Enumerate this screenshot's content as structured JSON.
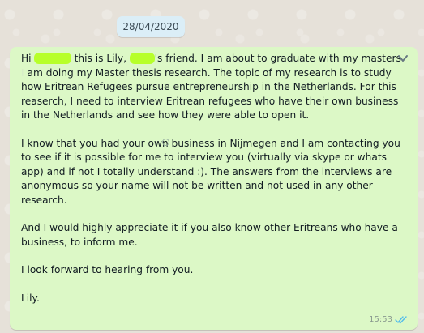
{
  "date_chip": "28/04/2020",
  "message": {
    "p1_part1": "Hi ",
    "p1_highlight1": "xxxxxx",
    "p1_part2": " this is Lily, ",
    "p1_highlight2": "xxxx",
    "p1_part3": "'s friend. I am about to graduate with my masters ",
    "p1_faded": "I",
    "p1_part4": " am doing my Master thesis research. The topic of my research is to study how Eritrean Refugees pursue entrepreneurship in the Netherlands. For this reaserch, I need to interview Eritrean refugees who have their own business in the Netherlands and see how they were able to open it.",
    "p2": "I know that you had your own business in Nijmegen and I am contacting you to see if it is possible for me to interview you (virtually via skype or whats app) and if not I totally understand :). The answers from the interviews are anonymous so your name will not be written and not used in any other research.",
    "p3": "And I would highly appreciate it if you also know other Eritreans who have a business, to inform me.",
    "p4": "I look forward to hearing from you.",
    "p5": "Lily.",
    "time": "15:53"
  },
  "colors": {
    "bubble": "#dcf8c6",
    "date_chip": "#dbeef7",
    "highlight": "#b7ff2a",
    "read_ticks": "#53bdeb"
  },
  "icons": [
    "chevron-down-icon",
    "double-check-icon"
  ]
}
